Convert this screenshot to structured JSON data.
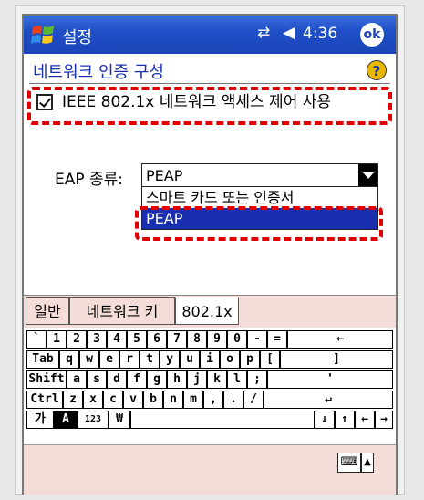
{
  "titlebar": {
    "app_title": "설정",
    "clock": "4:36",
    "ok_label": "ok",
    "net_icon": "⇄",
    "speaker_icon": "◀"
  },
  "page": {
    "title": "네트워크 인증 구성",
    "help_label": "?"
  },
  "ieee_checkbox": {
    "label": "IEEE 802.1x 네트워크 액세스 제어 사용",
    "checked": true
  },
  "eap": {
    "label": "EAP 종류:",
    "selected": "PEAP",
    "options": [
      "스마트 카드 또는 인증서",
      "PEAP"
    ],
    "highlighted_option": "PEAP"
  },
  "tabs": [
    {
      "label": "일반",
      "active": false
    },
    {
      "label": "네트워크 키",
      "active": false
    },
    {
      "label": "802.1x",
      "active": true
    }
  ],
  "keyboard": {
    "rows": [
      [
        "`",
        "1",
        "2",
        "3",
        "4",
        "5",
        "6",
        "7",
        "8",
        "9",
        "0",
        "-",
        "=",
        "←"
      ],
      [
        "Tab",
        "q",
        "w",
        "e",
        "r",
        "t",
        "y",
        "u",
        "i",
        "o",
        "p",
        "[",
        "]"
      ],
      [
        "Shift",
        "a",
        "s",
        "d",
        "f",
        "g",
        "h",
        "j",
        "k",
        "l",
        ";",
        "'"
      ],
      [
        "Ctrl",
        "z",
        "x",
        "c",
        "v",
        "b",
        "n",
        "m",
        ",",
        ".",
        "/",
        "↵"
      ],
      [
        "가",
        "A",
        "123",
        "₩",
        "",
        "↓",
        "↑",
        "←",
        "→"
      ]
    ]
  },
  "sip": {
    "keyboard_icon": "⌨",
    "arrow": "▲"
  },
  "colors": {
    "titlebar": "#1f4fc8",
    "highlight": "#1a2eb0",
    "annotation_red": "#e00000",
    "tab_bg": "#f4dcd8"
  }
}
